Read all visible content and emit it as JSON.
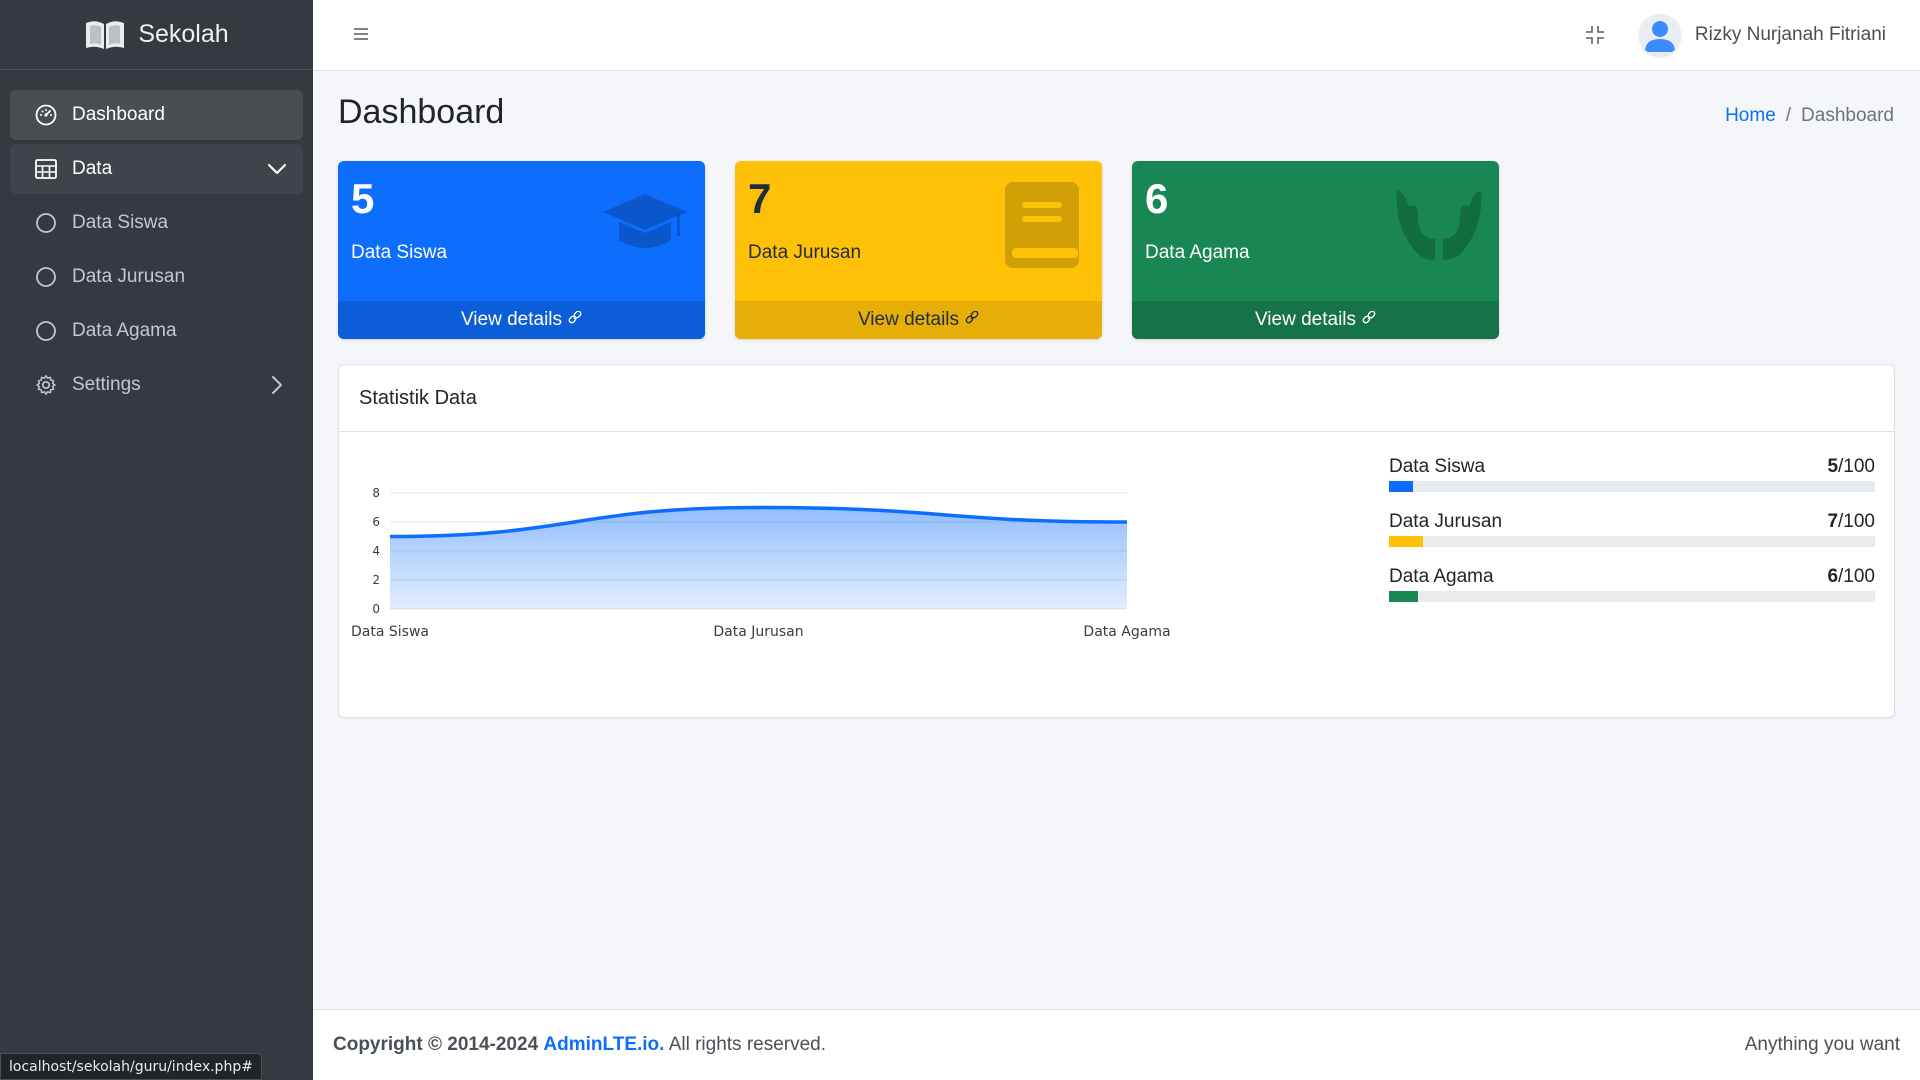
{
  "brand": {
    "name": "Sekolah",
    "icon": "open-book-icon"
  },
  "sidebar": {
    "items": [
      {
        "label": "Dashboard",
        "icon": "dashboard-gauge-icon"
      },
      {
        "label": "Data",
        "icon": "table-icon"
      },
      {
        "label": "Data Siswa",
        "icon": "circle-icon"
      },
      {
        "label": "Data Jurusan",
        "icon": "circle-icon"
      },
      {
        "label": "Data Agama",
        "icon": "circle-icon"
      },
      {
        "label": "Settings",
        "icon": "gear-icon"
      }
    ]
  },
  "topbar": {
    "user_name": "Rizky Nurjanah Fitriani"
  },
  "page": {
    "title": "Dashboard",
    "breadcrumb": {
      "home": "Home",
      "sep": "/",
      "current": "Dashboard"
    }
  },
  "stats": [
    {
      "value": "5",
      "label": "Data Siswa",
      "link": "View details",
      "color": "#0d6efd",
      "icon": "graduation-cap-icon"
    },
    {
      "value": "7",
      "label": "Data Jurusan",
      "link": "View details",
      "color": "#ffc107",
      "icon": "book-icon"
    },
    {
      "value": "6",
      "label": "Data Agama",
      "link": "View details",
      "color": "#198754",
      "icon": "hands-icon"
    }
  ],
  "card": {
    "title": "Statistik Data"
  },
  "chart_data": {
    "type": "area",
    "categories": [
      "Data Siswa",
      "Data Jurusan",
      "Data Agama"
    ],
    "values": [
      5,
      7,
      6
    ],
    "ylim": [
      0,
      8
    ],
    "yticks": [
      "0",
      "2",
      "4",
      "6",
      "8"
    ],
    "color": "#0d6efd",
    "grid": true
  },
  "progress": [
    {
      "label": "Data Siswa",
      "value": "5",
      "max": "/100",
      "fraction": 0.05,
      "color": "#0d6efd"
    },
    {
      "label": "Data Jurusan",
      "value": "7",
      "max": "/100",
      "fraction": 0.07,
      "color": "#ffc107"
    },
    {
      "label": "Data Agama",
      "value": "6",
      "max": "/100",
      "fraction": 0.06,
      "color": "#198754"
    }
  ],
  "footer": {
    "copyright": "Copyright © 2014-2024",
    "brand": "AdminLTE.io.",
    "rights": "All rights reserved.",
    "right_text": "Anything you want"
  },
  "statusbar": {
    "url": "localhost/sekolah/guru/index.php#"
  }
}
